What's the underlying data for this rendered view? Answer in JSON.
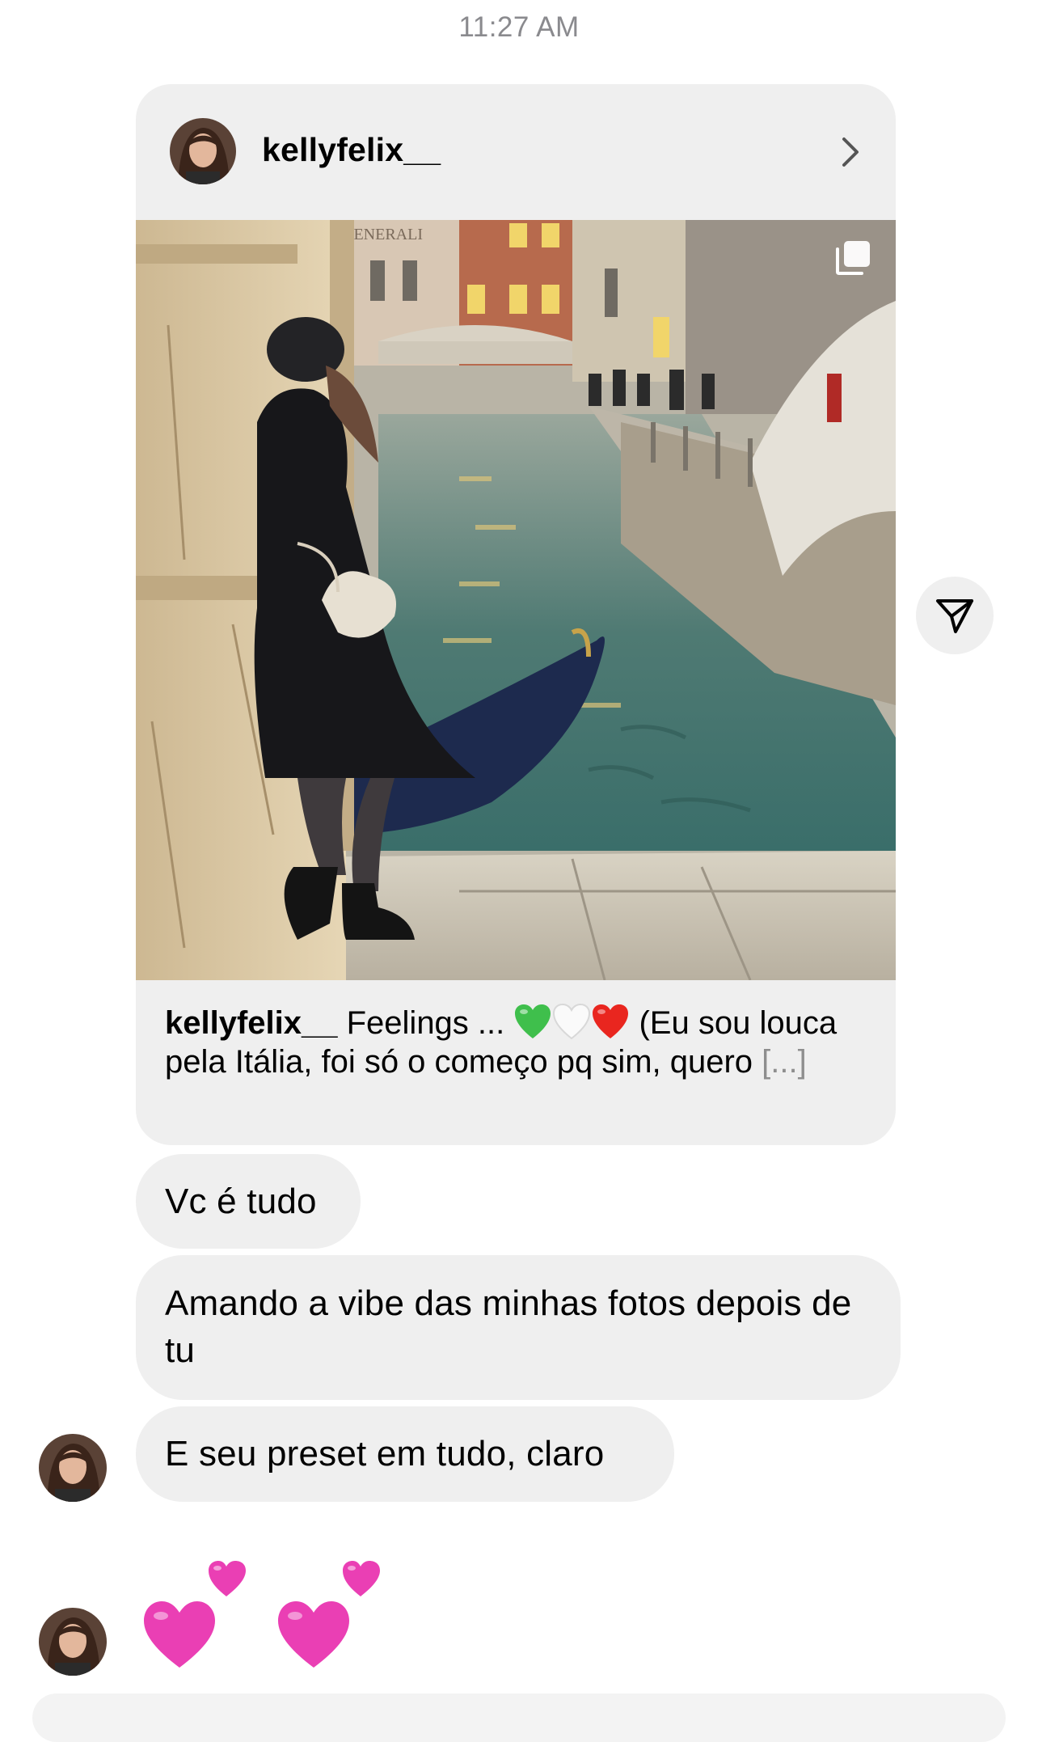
{
  "status": {
    "time": "11:27 AM"
  },
  "shared_post": {
    "username": "kellyfelix__",
    "image_icon": "photo-carousel",
    "caption_user": "kellyfelix__",
    "caption_text_1": " Feelings ... ",
    "caption_text_2": " (Eu sou louca pela Itália, foi só o começo pq sim, quero ",
    "caption_more": "[...]",
    "emoji": [
      "green-heart",
      "white-heart",
      "red-heart"
    ]
  },
  "messages": [
    {
      "text": "Vc é tudo"
    },
    {
      "text": "Amando a vibe das minhas fotos depois de tu"
    },
    {
      "text": "E seu preset em tudo, claro"
    }
  ],
  "reaction": {
    "emoji": "two-hearts",
    "count": 2
  },
  "colors": {
    "bubble": "#efefef",
    "timestamp": "#8a8a8e",
    "heart_pink": "#ea3fb4",
    "heart_green": "#3fbf4c",
    "heart_red": "#e9261f"
  }
}
